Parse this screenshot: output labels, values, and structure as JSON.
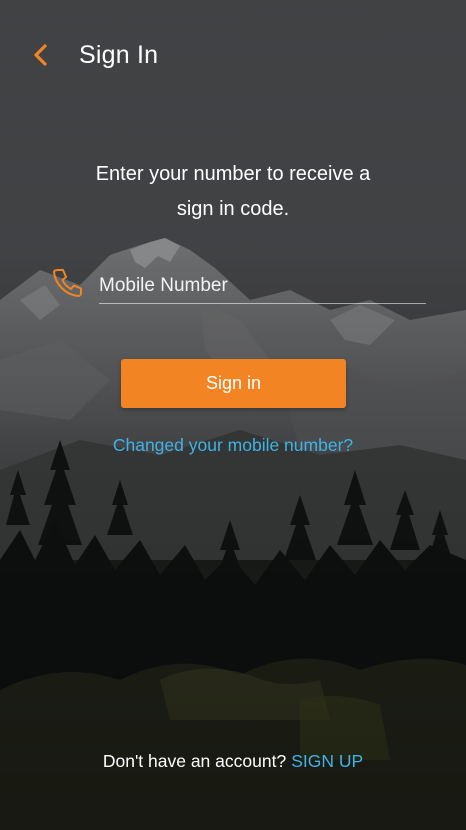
{
  "header": {
    "title": "Sign In",
    "back_icon": "chevron-left-icon",
    "accent_color": "#f28423"
  },
  "instruction": {
    "line1": "Enter your number to receive a",
    "line2": "sign in code."
  },
  "mobile_field": {
    "icon": "phone-icon",
    "placeholder": "Mobile Number",
    "value": ""
  },
  "signin_button": {
    "label": "Sign in",
    "color": "#f28423"
  },
  "changed_number_link": {
    "label": "Changed your mobile number?",
    "color": "#3fb2e6"
  },
  "footer": {
    "prompt": "Don't have an account?",
    "signup_label": "SIGN UP"
  }
}
